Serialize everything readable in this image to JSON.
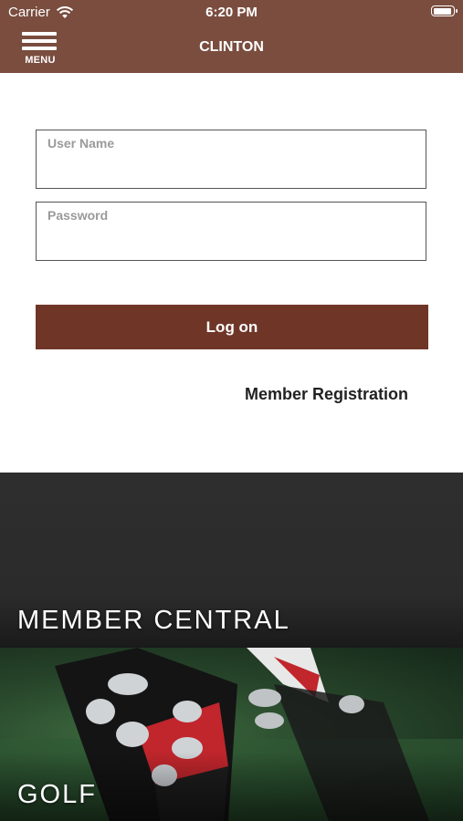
{
  "status_bar": {
    "carrier": "Carrier",
    "time": "6:20 PM"
  },
  "nav": {
    "menu_label": "MENU",
    "title": "CLINTON"
  },
  "login": {
    "username_label": "User Name",
    "password_label": "Password",
    "submit_label": "Log on",
    "register_label": "Member Registration"
  },
  "tiles": [
    {
      "label": "MEMBER CENTRAL"
    },
    {
      "label": "GOLF"
    }
  ],
  "colors": {
    "header": "#7a4d3f",
    "button": "#6f3628"
  }
}
